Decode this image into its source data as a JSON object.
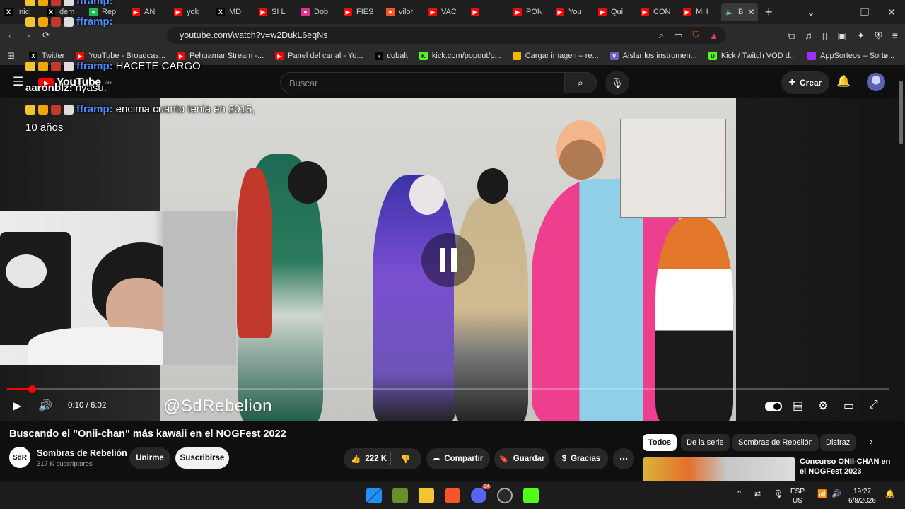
{
  "browser": {
    "tabs": [
      {
        "label": "Inici",
        "icon": "x-icon",
        "color": "#000000"
      },
      {
        "label": "dem",
        "icon": "x-icon",
        "color": "#000000"
      },
      {
        "label": "Rep",
        "icon": "spotify-icon",
        "color": "#1db954"
      },
      {
        "label": "AN",
        "icon": "yt-icon",
        "color": "#ff0000"
      },
      {
        "label": "yok",
        "icon": "yt-icon",
        "color": "#ff0000"
      },
      {
        "label": "MD",
        "icon": "x-icon",
        "color": "#000000"
      },
      {
        "label": "SI L",
        "icon": "yt-icon",
        "color": "#ff0000"
      },
      {
        "label": "Dob",
        "icon": "star-icon",
        "color": "#e0318c"
      },
      {
        "label": "FIES",
        "icon": "yt-icon",
        "color": "#ff0000"
      },
      {
        "label": "vilor",
        "icon": "brave-icon",
        "color": "#fb542b"
      },
      {
        "label": "VAC",
        "icon": "yt-icon",
        "color": "#ff0000"
      },
      {
        "label": "",
        "icon": "yt-icon",
        "color": "#ff0000"
      },
      {
        "label": "PON",
        "icon": "yt-icon",
        "color": "#ff0000"
      },
      {
        "label": "You",
        "icon": "yt-icon",
        "color": "#ff0000"
      },
      {
        "label": "Qui",
        "icon": "yt-icon",
        "color": "#ff0000"
      },
      {
        "label": "CON",
        "icon": "yt-icon",
        "color": "#ff0000"
      },
      {
        "label": "Mi I",
        "icon": "yt-icon",
        "color": "#ff0000"
      },
      {
        "label": "B",
        "icon": "audio-icon",
        "color": "#ffffff",
        "active": true
      }
    ],
    "url": "youtube.com/watch?v=w2DukL6eqNs",
    "bookmarks": [
      {
        "label": "Twitter",
        "icon": "x-icon",
        "color": "#000000"
      },
      {
        "label": "YouTube - Broadcas...",
        "icon": "yt-icon",
        "color": "#ff0000"
      },
      {
        "label": "Pehuamar Stream -...",
        "icon": "yt-icon",
        "color": "#ff0000"
      },
      {
        "label": "Panel del canal - Yo...",
        "icon": "yt-icon",
        "color": "#ff0000"
      },
      {
        "label": "cobalt",
        "icon": "cobalt-icon",
        "color": "#000000"
      },
      {
        "label": "kick.com/popout/p...",
        "icon": "kick-icon",
        "color": "#53fc18"
      },
      {
        "label": "Cargar imagen – re...",
        "icon": "image-icon",
        "color": "#f4b400"
      },
      {
        "label": "Aislar los instrumen...",
        "icon": "v-icon",
        "color": "#6c5fc7"
      },
      {
        "label": "Kick / Twitch VOD d...",
        "icon": "d-icon",
        "color": "#53fc18"
      },
      {
        "label": "AppSorteos – Sorte...",
        "icon": "gift-icon",
        "color": "#9b30ff"
      }
    ]
  },
  "youtube": {
    "logo_text": "YouTube",
    "region": "AR",
    "search_placeholder": "Buscar",
    "create_label": "Crear",
    "video": {
      "watermark": "@SdRebelion",
      "current_time": "0:10",
      "duration": "6:02",
      "time_display": "0:10 / 6:02",
      "progress_fraction": 0.028,
      "title": "Buscando el \"Onii-chan\" más kawaii en el NOGFest 2022"
    },
    "channel": {
      "logo_text": "SdR",
      "name": "Sombras de Rebelión",
      "subscribers": "317 K suscriptores",
      "join_label": "Unirme",
      "subscribe_label": "Suscribirse"
    },
    "actions": {
      "likes": "222 K",
      "share": "Compartir",
      "save": "Guardar",
      "thanks": "Gracias"
    },
    "chips": [
      "Todos",
      "De la serie",
      "Sombras de Rebelión",
      "Disfraz"
    ],
    "recommendation": {
      "title": "Concurso ONII-CHAN en el NOGFest 2023"
    }
  },
  "stream_chat": [
    {
      "user": "fframp:",
      "message": "",
      "badges": true
    },
    {
      "user": "fframp:",
      "message": "",
      "badges": true
    },
    {
      "user": "fframp:",
      "message": "HACETE CARGO",
      "badges": true
    },
    {
      "user": "aaronblz:",
      "message": "nyasu.",
      "badges": false
    },
    {
      "user": "fframp:",
      "message": "encima cuanto tenia en 2015,",
      "badges": true
    },
    {
      "user": "",
      "message": "10 años",
      "badges": false
    }
  ],
  "taskbar": {
    "lang_top": "ESP",
    "lang_bottom": "US",
    "time": "19:27",
    "date": "6/8/2026",
    "discord_badge": "94"
  }
}
